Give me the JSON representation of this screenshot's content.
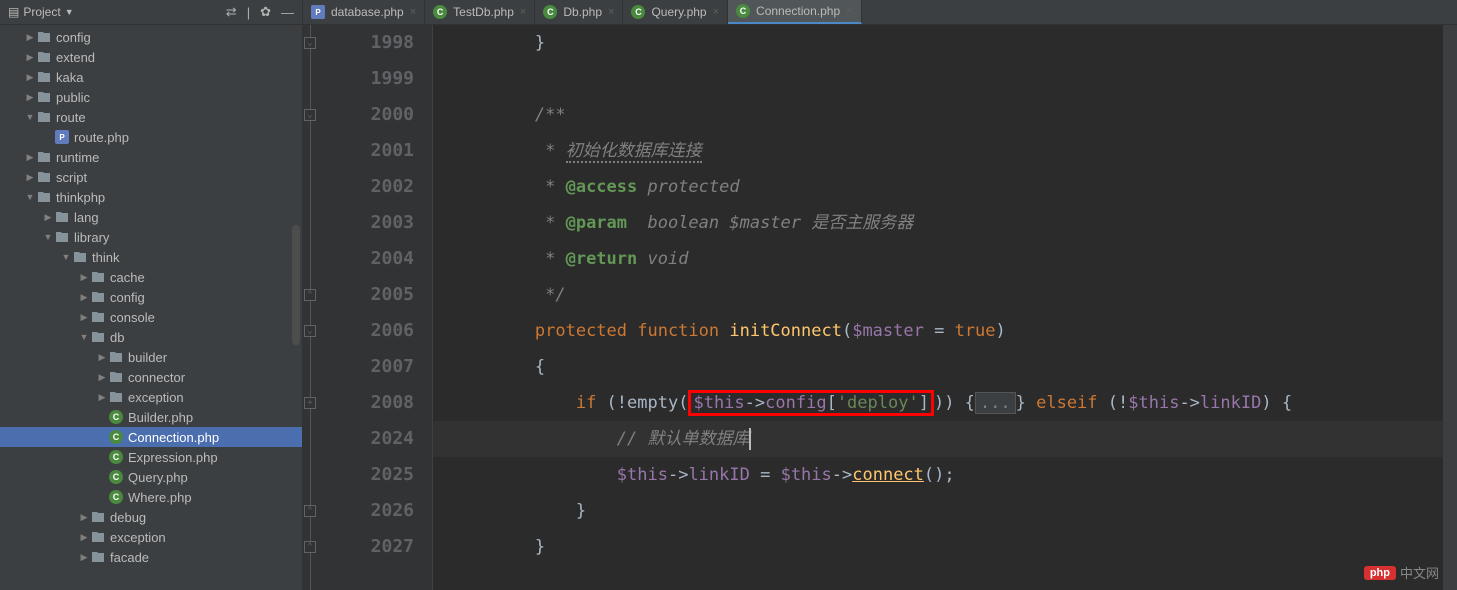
{
  "sidebar": {
    "title": "Project",
    "tree": [
      {
        "indent": 1,
        "arrow": "▶",
        "icon": "folder",
        "label": "config"
      },
      {
        "indent": 1,
        "arrow": "▶",
        "icon": "folder",
        "label": "extend"
      },
      {
        "indent": 1,
        "arrow": "▶",
        "icon": "folder",
        "label": "kaka"
      },
      {
        "indent": 1,
        "arrow": "▶",
        "icon": "folder",
        "label": "public"
      },
      {
        "indent": 1,
        "arrow": "▼",
        "icon": "folder",
        "label": "route"
      },
      {
        "indent": 2,
        "arrow": "",
        "icon": "php",
        "label": "route.php"
      },
      {
        "indent": 1,
        "arrow": "▶",
        "icon": "folder",
        "label": "runtime"
      },
      {
        "indent": 1,
        "arrow": "▶",
        "icon": "folder",
        "label": "script"
      },
      {
        "indent": 1,
        "arrow": "▼",
        "icon": "folder",
        "label": "thinkphp"
      },
      {
        "indent": 2,
        "arrow": "▶",
        "icon": "folder",
        "label": "lang"
      },
      {
        "indent": 2,
        "arrow": "▼",
        "icon": "folder",
        "label": "library"
      },
      {
        "indent": 3,
        "arrow": "▼",
        "icon": "folder",
        "label": "think"
      },
      {
        "indent": 4,
        "arrow": "▶",
        "icon": "folder",
        "label": "cache"
      },
      {
        "indent": 4,
        "arrow": "▶",
        "icon": "folder",
        "label": "config"
      },
      {
        "indent": 4,
        "arrow": "▶",
        "icon": "folder",
        "label": "console"
      },
      {
        "indent": 4,
        "arrow": "▼",
        "icon": "folder",
        "label": "db"
      },
      {
        "indent": 5,
        "arrow": "▶",
        "icon": "folder",
        "label": "builder"
      },
      {
        "indent": 5,
        "arrow": "▶",
        "icon": "folder",
        "label": "connector"
      },
      {
        "indent": 5,
        "arrow": "▶",
        "icon": "folder",
        "label": "exception"
      },
      {
        "indent": 5,
        "arrow": "",
        "icon": "class",
        "label": "Builder.php"
      },
      {
        "indent": 5,
        "arrow": "",
        "icon": "class",
        "label": "Connection.php",
        "selected": true
      },
      {
        "indent": 5,
        "arrow": "",
        "icon": "class",
        "label": "Expression.php"
      },
      {
        "indent": 5,
        "arrow": "",
        "icon": "class",
        "label": "Query.php"
      },
      {
        "indent": 5,
        "arrow": "",
        "icon": "class",
        "label": "Where.php"
      },
      {
        "indent": 4,
        "arrow": "▶",
        "icon": "folder",
        "label": "debug"
      },
      {
        "indent": 4,
        "arrow": "▶",
        "icon": "folder",
        "label": "exception"
      },
      {
        "indent": 4,
        "arrow": "▶",
        "icon": "folder",
        "label": "facade"
      }
    ]
  },
  "tabs": [
    {
      "icon": "php",
      "label": "database.php",
      "active": false
    },
    {
      "icon": "class",
      "label": "TestDb.php",
      "active": false
    },
    {
      "icon": "class",
      "label": "Db.php",
      "active": false
    },
    {
      "icon": "class",
      "label": "Query.php",
      "active": false
    },
    {
      "icon": "class",
      "label": "Connection.php",
      "active": true
    }
  ],
  "lineNumbers": [
    "1998",
    "1999",
    "2000",
    "2001",
    "2002",
    "2003",
    "2004",
    "2005",
    "2006",
    "2007",
    "2008",
    "2024",
    "2025",
    "2026",
    "2027"
  ],
  "code": {
    "l0": "        }",
    "l2a": "        /**",
    "l3a": "         * ",
    "l3b": "初始化数据库连接",
    "l4a": "         * ",
    "l4b": "@access",
    "l4c": " protected",
    "l5a": "         * ",
    "l5b": "@param",
    "l5c": "  boolean $master 是否主服务器",
    "l6a": "         * ",
    "l6b": "@return",
    "l6c": " void",
    "l7a": "         */",
    "l8a": "        ",
    "l8b": "protected function ",
    "l8c": "initConnect",
    "l8d": "(",
    "l8e": "$master",
    "l8f": " = ",
    "l8g": "true",
    "l8h": ")",
    "l9": "        {",
    "l10a": "            ",
    "l10b": "if ",
    "l10c": "(!",
    "l10d": "empty",
    "l10e": "(",
    "l10f": "$this",
    "l10g": "->",
    "l10h": "config",
    "l10i": "[",
    "l10j": "'deploy'",
    "l10k": "]",
    "l10l": ")) {",
    "l10m": "...",
    "l10n": "} ",
    "l10o": "elseif ",
    "l10p": "(!",
    "l10q": "$this",
    "l10r": "->",
    "l10s": "linkID",
    "l10t": ") {",
    "l11a": "                ",
    "l11b": "// 默认单数据库",
    "l12a": "                ",
    "l12b": "$this",
    "l12c": "->",
    "l12d": "linkID",
    "l12e": " = ",
    "l12f": "$this",
    "l12g": "->",
    "l12h": "connect",
    "l12i": "();",
    "l13": "            }",
    "l14": "        }"
  },
  "watermark": {
    "badge": "php",
    "text": "中文网"
  }
}
